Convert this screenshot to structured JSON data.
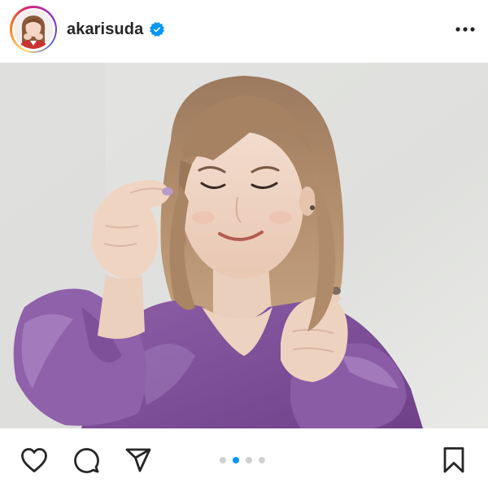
{
  "post": {
    "username": "akarisuda",
    "verified": true,
    "header_icons": {
      "verified": "verified-badge-icon",
      "more": "more-options-icon"
    },
    "media": {
      "type": "photo",
      "carousel": {
        "count": 4,
        "current_index": 1
      }
    },
    "actions": {
      "like": "heart-icon",
      "comment": "comment-bubble-icon",
      "share": "paper-plane-icon",
      "save": "bookmark-icon"
    },
    "colors": {
      "accent": "#0095f6",
      "inactive_dot": "#d0d0d0",
      "text": "#262626"
    }
  }
}
